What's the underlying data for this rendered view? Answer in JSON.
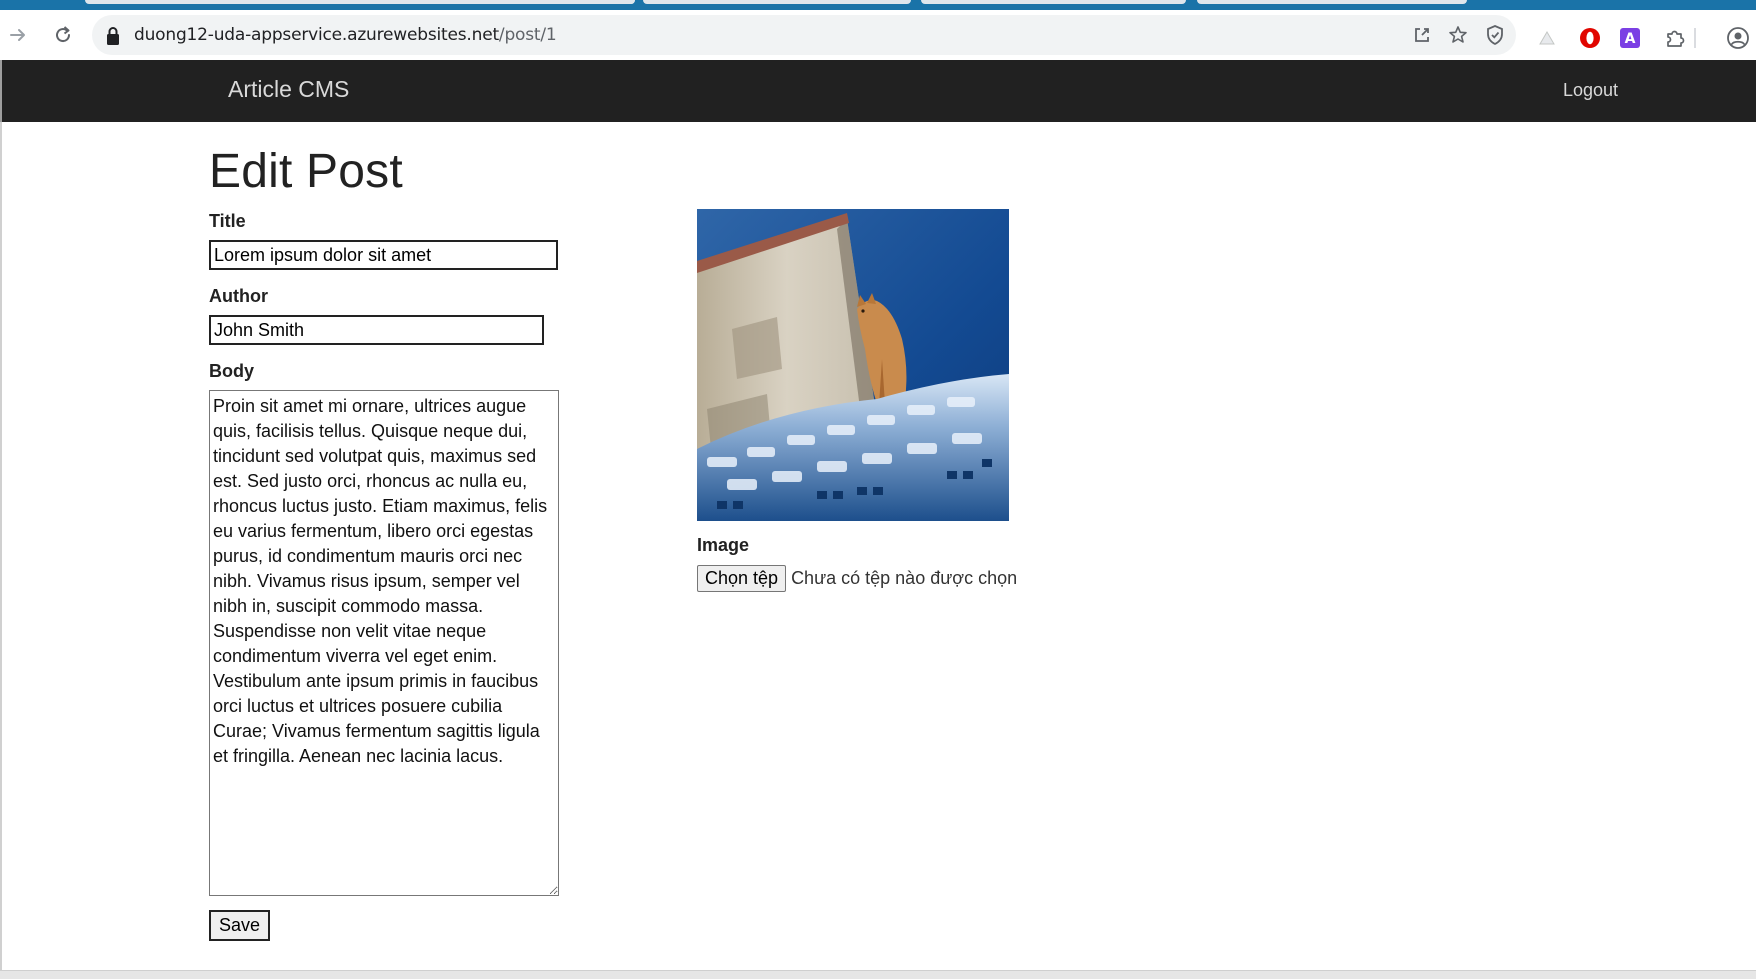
{
  "browser": {
    "url_host": "duong12-uda-appservice.azurewebsites.net",
    "url_path": "/post/1"
  },
  "navbar": {
    "brand": "Article CMS",
    "logout_label": "Logout"
  },
  "page": {
    "title": "Edit Post"
  },
  "form": {
    "title_label": "Title",
    "title_value": "Lorem ipsum dolor sit amet",
    "author_label": "Author",
    "author_value": "John Smith",
    "body_label": "Body",
    "body_value": "Proin sit amet mi ornare, ultrices augue quis, facilisis tellus. Quisque neque dui, tincidunt sed volutpat quis, maximus sed est. Sed justo orci, rhoncus ac nulla eu, rhoncus luctus justo. Etiam maximus, felis eu varius fermentum, libero orci egestas purus, id condimentum mauris orci nec nibh. Vivamus risus ipsum, semper vel nibh in, suscipit commodo massa. Suspendisse non velit vitae neque condimentum viverra vel eget enim. Vestibulum ante ipsum primis in faucibus orci luctus et ultrices posuere cubilia Curae; Vivamus fermentum sagittis ligula et fringilla. Aenean nec lacinia lacus.",
    "save_label": "Save",
    "image_label": "Image",
    "file_button_label": "Chọn tệp",
    "file_status": "Chưa có tệp nào được chọn"
  },
  "colors": {
    "navbar_bg": "#212121",
    "navbar_text": "#d9d9d9",
    "tabstrip": "#1a73a8"
  },
  "icons": {
    "back": "arrow-right-icon",
    "reload": "reload-icon",
    "lock": "lock-icon",
    "share": "share-icon",
    "bookmark": "star-icon",
    "shield": "shield-icon",
    "extensions": "puzzle-icon",
    "profile": "profile-icon"
  }
}
